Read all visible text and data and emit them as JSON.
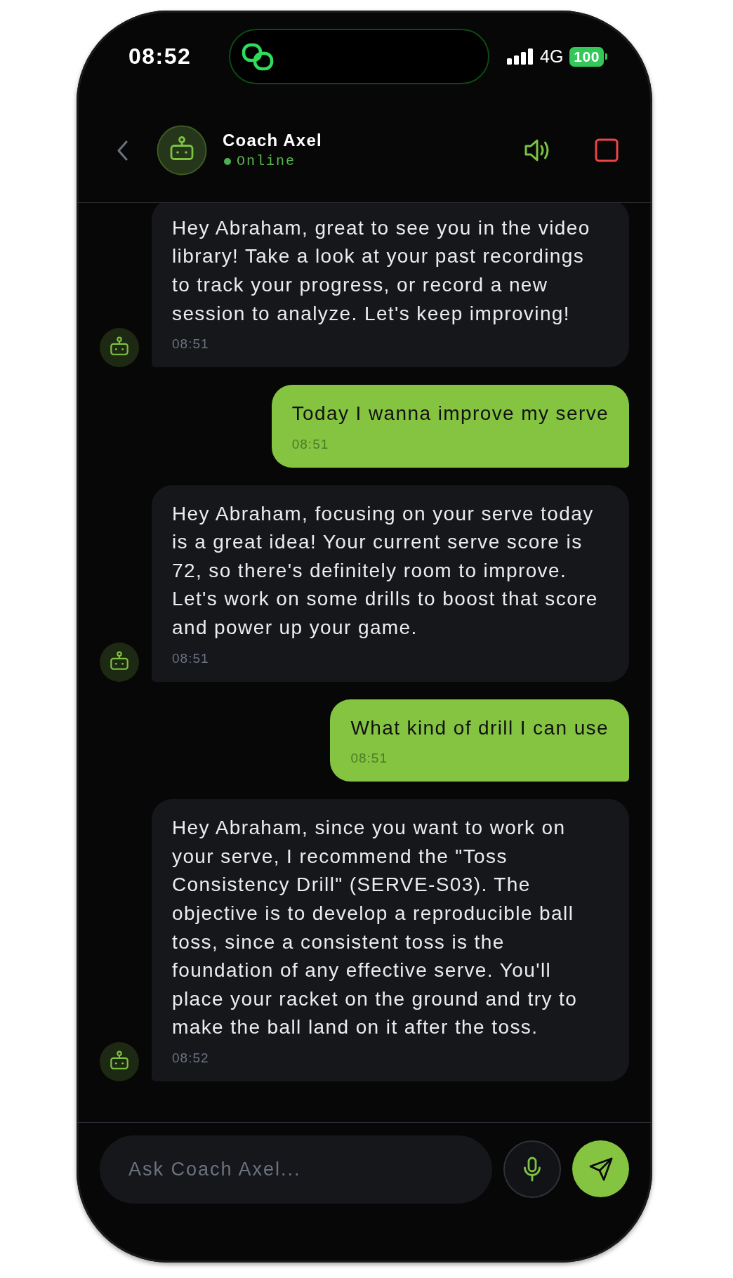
{
  "status_bar": {
    "time": "08:52",
    "network": "4G",
    "battery": "100"
  },
  "header": {
    "title": "Coach Axel",
    "status": "Online",
    "online": true
  },
  "messages": [
    {
      "kind": "bot",
      "text": "Hey Abraham, great to see you in the video library! Take a look at your past recordings to track your progress, or record a new session to analyze. Let's keep improving!",
      "time": "08:51"
    },
    {
      "kind": "user",
      "text": "Today I wanna improve my serve",
      "time": "08:51"
    },
    {
      "kind": "bot",
      "text": "Hey Abraham, focusing on your serve today is a great idea! Your current serve score is 72, so there's definitely room to improve. Let's work on some drills to boost that score and power up your game.",
      "time": "08:51"
    },
    {
      "kind": "user",
      "text": "What kind of drill I can use",
      "time": "08:51"
    },
    {
      "kind": "bot",
      "text": "Hey Abraham, since you want to work on your serve, I recommend the \"Toss Consistency Drill\" (SERVE-S03). The objective is to develop a reproducible ball toss, since a consistent toss is the foundation of any effective serve. You'll place your racket on the ground and try to make the ball land on it after the toss.",
      "time": "08:52"
    }
  ],
  "composer": {
    "placeholder": "Ask Coach Axel..."
  }
}
